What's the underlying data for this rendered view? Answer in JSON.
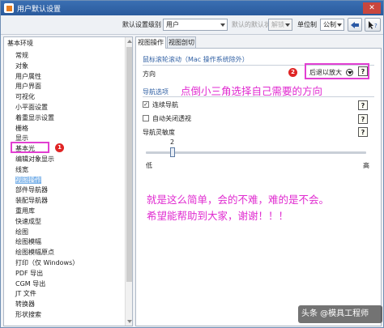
{
  "window": {
    "title": "用户默认设置",
    "close_label": "✕"
  },
  "toolbar": {
    "level_label": "默认设置级别",
    "level_value": "用户",
    "state_label": "默认的默认状态",
    "state_value": "解锁",
    "unit_label": "单位制",
    "unit_value": "公制"
  },
  "tree": {
    "root": "基本环境",
    "items": [
      "常规",
      "对象",
      "用户属性",
      "用户界面",
      "可视化",
      "小平面设置",
      "着重显示设置",
      "栅格",
      "显示",
      "基本光",
      "编辑对象显示",
      "线宽",
      "视图操作",
      "部件导航器",
      "装配导航器",
      "重用库",
      "快速成型",
      "绘图",
      "绘图模幅",
      "绘图模幅原点",
      "打印（仅 Windows）",
      "PDF 导出",
      "CGM 导出",
      "JT 文件",
      "转换器",
      "形状搜索"
    ],
    "selected_index": 12
  },
  "tabs": [
    {
      "label": "视图操作"
    },
    {
      "label": "视图剖切"
    }
  ],
  "scroll_section": {
    "title": "鼠标滚轮滚动（Mac 操作系统除外）",
    "direction_label": "方向",
    "direction_value": "后退以放大"
  },
  "nav_section": {
    "title": "导航选项",
    "continuous_nav_label": "连续导航",
    "continuous_nav_checked": true,
    "auto_close_label": "自动关闭透视",
    "auto_close_checked": false,
    "sensitivity_label": "导航灵敏度",
    "sensitivity_value": "2",
    "low_label": "低",
    "high_label": "高"
  },
  "annotations": {
    "badge1": "1",
    "badge2": "2",
    "note_top": "点倒小三角选择自己需要的方向",
    "note_bottom_1": "就是这么简单，会的不难，难的是不会。",
    "note_bottom_2": "希望能帮助到大家，谢谢！！！"
  },
  "watermark": "头条 @模具工程师",
  "help_glyph": "?",
  "colors": {
    "annotation": "#e23fd2",
    "badge": "#e02424",
    "accent": "#2f5fa3"
  }
}
